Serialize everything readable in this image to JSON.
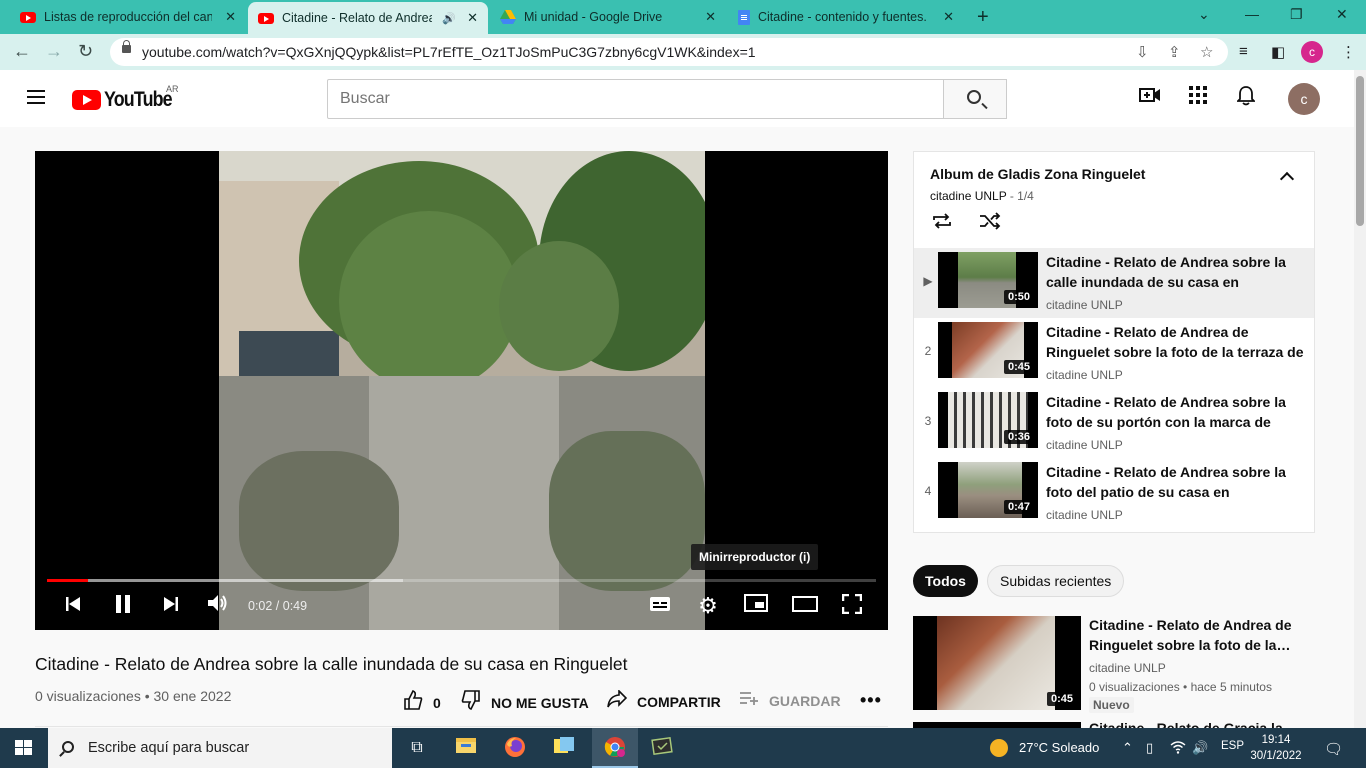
{
  "browser": {
    "tabs": [
      {
        "title": "Listas de reproducción del canal",
        "icon": "youtube-favicon",
        "active": false
      },
      {
        "title": "Citadine - Relato de Andrea",
        "icon": "youtube-favicon",
        "active": true,
        "audio_icon": "speaker-icon"
      },
      {
        "title": "Mi unidad - Google Drive",
        "icon": "google-drive-favicon",
        "active": false
      },
      {
        "title": "Citadine - contenido y fuentes.do",
        "icon": "google-docs-favicon",
        "active": false
      }
    ],
    "url": "youtube.com/watch?v=QxGXnjQQypk&list=PL7rEfTE_Oz1TJoSmPuC3G7zbny6cgV1WK&index=1",
    "profile_initial": "c"
  },
  "youtube": {
    "logo_text": "YouTube",
    "country_code": "AR",
    "search_placeholder": "Buscar",
    "avatar_initial": "c"
  },
  "player": {
    "progress_fraction": 0.05,
    "buffered_fraction": 0.43,
    "time": "0:02 / 0:49",
    "tooltip": "Minirreproductor (i)"
  },
  "video": {
    "title": "Citadine - Relato de Andrea sobre la calle inundada de su casa en Ringuelet",
    "meta": "0 visualizaciones • 30 ene 2022",
    "likes": "0",
    "dislike_label": "NO ME GUSTA",
    "share_label": "COMPARTIR",
    "save_label": "GUARDAR"
  },
  "playlist": {
    "title": "Album de Gladis Zona Ringuelet",
    "channel": "citadine UNLP",
    "position": " - 1/4",
    "items": [
      {
        "index": "▶",
        "title": "Citadine - Relato de Andrea sobre la calle inundada de su casa en Ringuelet",
        "channel": "citadine UNLP",
        "duration": "0:50"
      },
      {
        "index": "2",
        "title": "Citadine - Relato de Andrea de Ringuelet sobre la foto de la terraza de su casa…",
        "channel": "citadine UNLP",
        "duration": "0:45"
      },
      {
        "index": "3",
        "title": "Citadine - Relato de Andrea sobre la foto de su portón con la marca de agu…",
        "channel": "citadine UNLP",
        "duration": "0:36"
      },
      {
        "index": "4",
        "title": "Citadine - Relato de Andrea sobre la foto del patio de su casa en Ringuelet.,…",
        "channel": "citadine UNLP",
        "duration": "0:47"
      }
    ]
  },
  "chips": {
    "all": "Todos",
    "recent": "Subidas recientes"
  },
  "recommendation": {
    "title": "Citadine - Relato de Andrea de Ringuelet sobre la foto de la…",
    "channel": "citadine UNLP",
    "meta": "0 visualizaciones • hace 5 minutos",
    "badge": "Nuevo",
    "duration": "0:45",
    "next_title": "Citadine - Relato de Gracia la…"
  },
  "taskbar": {
    "search_placeholder": "Escribe aquí para buscar",
    "weather": "27°C  Soleado",
    "language": "ESP",
    "time": "19:14",
    "date": "30/1/2022"
  }
}
